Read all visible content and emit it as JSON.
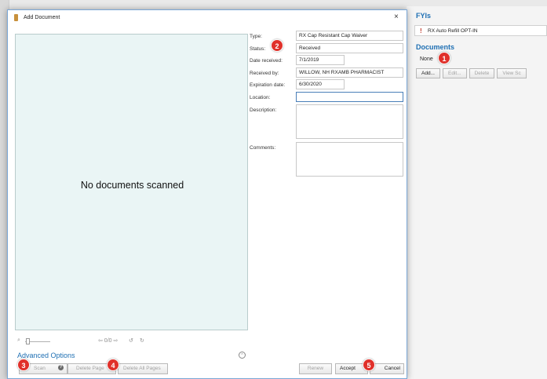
{
  "background": {
    "fyi": {
      "header": "FYIs",
      "item": "RX Auto Refill OPT-IN",
      "flag_icon": "flag-icon"
    },
    "documents": {
      "header": "Documents",
      "none_text": "None",
      "buttons": {
        "add": "Add...",
        "edit": "Edit...",
        "delete": "Delete",
        "view": "View Sc"
      }
    }
  },
  "dialog": {
    "title": "Add Document",
    "close": "×",
    "scan_area": {
      "empty_text": "No documents scanned"
    },
    "view_controls": {
      "zoom_icon": "⌕",
      "page_nav": "⇦ 0/0 ⇨",
      "rotate_left": "↺",
      "rotate_right": "↻"
    },
    "advanced_options": "Advanced Options",
    "advanced_toggle": "⌃",
    "buttons": {
      "scan": "Scan",
      "help": "?",
      "delete_page": "Delete Page",
      "delete_all_pages": "Delete All Pages",
      "renew": "Renew",
      "accept": "Accept",
      "cancel": "Cancel"
    },
    "form": {
      "type": {
        "label": "Type:",
        "value": "RX Cap Resistant Cap Waiver"
      },
      "status": {
        "label": "Status:",
        "value": "Received"
      },
      "date_received": {
        "label": "Date received:",
        "value": "7/1/2019"
      },
      "received_by": {
        "label": "Received by:",
        "value": "WILLOW, NH RXAMB PHARMACIST"
      },
      "expiration_date": {
        "label": "Expiration date:",
        "value": "6/30/2020"
      },
      "location": {
        "label": "Location:",
        "value": ""
      },
      "description": {
        "label": "Description:",
        "value": ""
      },
      "comments": {
        "label": "Comments:",
        "value": ""
      }
    }
  },
  "callouts": [
    "1",
    "2",
    "3",
    "4",
    "5"
  ],
  "colors": {
    "accent": "#1e6fb3",
    "callout": "#e0302a",
    "scan_bg": "#eaf5f5",
    "dialog_border": "#7aa7d6"
  }
}
